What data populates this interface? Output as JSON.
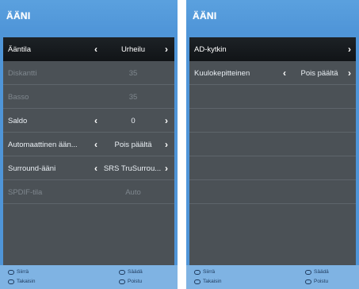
{
  "left_panel": {
    "title": "ÄÄNI",
    "rows": [
      {
        "label": "Ääntila",
        "value": "Urheilu",
        "left_arrow": "‹",
        "right_arrow": "›",
        "selected": true,
        "dim": false
      },
      {
        "label": "Diskantti",
        "value": "35",
        "dim": true
      },
      {
        "label": "Basso",
        "value": "35",
        "dim": true
      },
      {
        "label": "Saldo",
        "value": "0",
        "left_arrow": "‹",
        "right_arrow": "›",
        "dim": false
      },
      {
        "label": "Automaattinen ään...",
        "value": "Pois päältä",
        "left_arrow": "‹",
        "right_arrow": "›",
        "dim": false
      },
      {
        "label": "Surround-ääni",
        "value": "SRS TruSurrou...",
        "left_arrow": "‹",
        "right_arrow": "›",
        "dim": false
      },
      {
        "label": "SPDIF-tila",
        "value": "Auto",
        "dim": true
      }
    ],
    "footer": {
      "move": "Siirrä",
      "back": "Takaisin",
      "adjust": "Säädä",
      "exit": "Poistu"
    }
  },
  "right_panel": {
    "title": "ÄÄNI",
    "rows": [
      {
        "label": "AD-kytkin",
        "value": "",
        "right_arrow": "›",
        "selected": true
      },
      {
        "label": "Kuulokepitteinen",
        "value": "Pois päältä",
        "left_arrow": "‹",
        "right_arrow": "›",
        "selected": false
      }
    ],
    "empty_rows": 6,
    "footer": {
      "move": "Siirrä",
      "back": "Takaisin",
      "adjust": "Säädä",
      "exit": "Poistu"
    }
  }
}
